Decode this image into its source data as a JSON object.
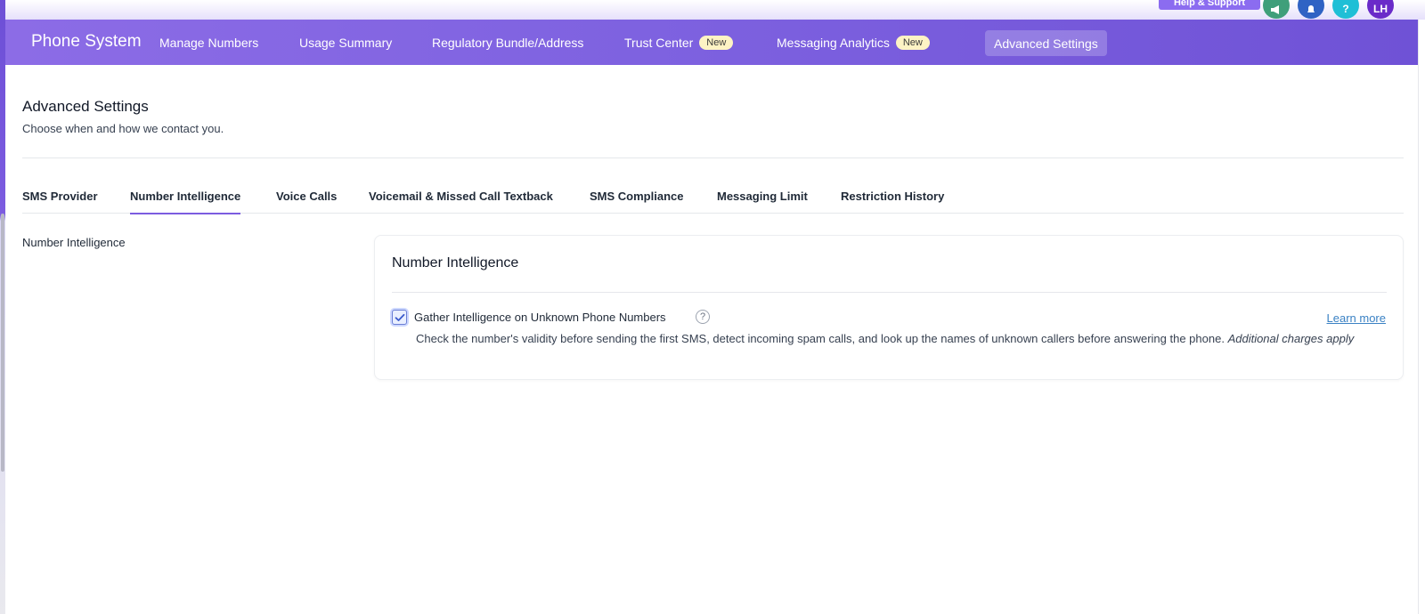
{
  "topbar": {
    "help_label": "Help & Support",
    "icons": [
      "megaphone-icon",
      "bell-icon",
      "question-icon"
    ],
    "avatar_initials": "LH",
    "colors": {
      "megaphone": "#3f9f7a",
      "bell": "#2f63c4",
      "question": "#1fbfd6",
      "avatar": "#6a2bc9"
    }
  },
  "nav": {
    "brand": "Phone System",
    "items": [
      {
        "label": "Manage Numbers"
      },
      {
        "label": "Usage Summary"
      },
      {
        "label": "Regulatory Bundle/Address"
      },
      {
        "label": "Trust Center",
        "badge": "New"
      },
      {
        "label": "Messaging Analytics",
        "badge": "New"
      },
      {
        "label": "Advanced Settings",
        "active": true
      }
    ]
  },
  "page": {
    "title": "Advanced Settings",
    "subtitle": "Choose when and how we contact you."
  },
  "tabs": [
    {
      "label": "SMS Provider"
    },
    {
      "label": "Number Intelligence",
      "active": true
    },
    {
      "label": "Voice Calls"
    },
    {
      "label": "Voicemail & Missed Call Textback"
    },
    {
      "label": "SMS Compliance"
    },
    {
      "label": "Messaging Limit"
    },
    {
      "label": "Restriction History"
    }
  ],
  "section": {
    "side_label": "Number Intelligence",
    "card_title": "Number Intelligence",
    "option": {
      "label": "Gather Intelligence on Unknown Phone Numbers",
      "checked": true,
      "help": "?",
      "learn_more": "Learn more",
      "description": "Check the number's validity before sending the first SMS, detect incoming spam calls, and look up the names of unknown callers before answering the phone.",
      "description_italic": "Additional charges apply"
    }
  },
  "colors": {
    "accent": "#7c5ce0",
    "link": "#3b82c4",
    "badge_bg": "#fdf3c4"
  }
}
